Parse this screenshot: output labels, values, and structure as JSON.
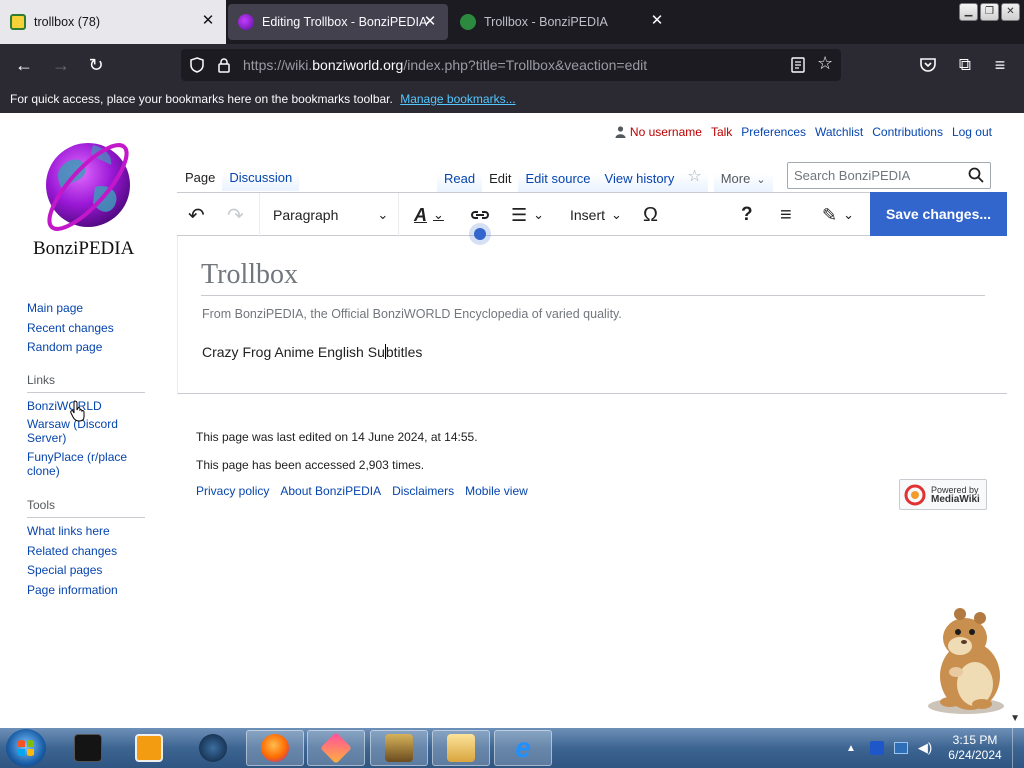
{
  "browser": {
    "tabs": [
      {
        "title": "trollbox (78)"
      },
      {
        "title": "Editing Trollbox - BonziPEDIA"
      },
      {
        "title": "Trollbox - BonziPEDIA"
      }
    ],
    "url_prefix": "https://wiki.",
    "url_domain": "bonziworld.org",
    "url_suffix": "/index.php?title=Trollbox&veaction=edit",
    "bookmark_hint": "For quick access, place your bookmarks here on the bookmarks toolbar.",
    "bookmark_link": "Manage bookmarks..."
  },
  "wiki": {
    "logo_title": "BonziPEDIA",
    "personal": {
      "user": "No username",
      "talk": "Talk",
      "preferences": "Preferences",
      "watchlist": "Watchlist",
      "contributions": "Contributions",
      "logout": "Log out"
    },
    "tabs_left": [
      "Page",
      "Discussion"
    ],
    "tabs_right": [
      "Read",
      "Edit",
      "Edit source",
      "View history"
    ],
    "more": "More",
    "search_placeholder": "Search BonziPEDIA",
    "sidebar": {
      "nav": [
        "Main page",
        "Recent changes",
        "Random page"
      ],
      "links_heading": "Links",
      "links": [
        "BonziWORLD",
        "Warsaw (Discord Server)",
        "FunyPlace (r/place clone)"
      ],
      "tools_heading": "Tools",
      "tools": [
        "What links here",
        "Related changes",
        "Special pages",
        "Page information"
      ]
    },
    "toolbar": {
      "paragraph": "Paragraph",
      "insert": "Insert",
      "save": "Save changes..."
    },
    "article": {
      "title": "Trollbox",
      "tagline": "From BonziPEDIA, the Official BonziWORLD Encyclopedia of varied quality.",
      "body_before_cursor": "Crazy Frog Anime English Su",
      "body_after_cursor": "btitles"
    },
    "footer": {
      "last_edited": "This page was last edited on 14 June 2024, at 14:55.",
      "accessed": "This page has been accessed 2,903 times.",
      "links": [
        "Privacy policy",
        "About BonziPEDIA",
        "Disclaimers",
        "Mobile view"
      ],
      "powered_by_line1": "Powered by",
      "powered_by_line2": "MediaWiki"
    }
  },
  "taskbar": {
    "time": "3:15 PM",
    "date": "6/24/2024"
  },
  "colors": {
    "link": "#0645ad",
    "save_button": "#3366cc",
    "redlink": "#ba0000"
  }
}
